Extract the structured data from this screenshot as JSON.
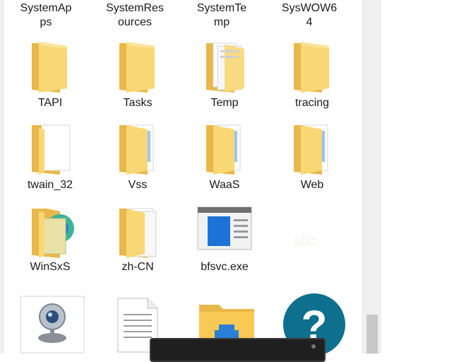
{
  "top_row": [
    {
      "name": "SystemApps",
      "line1": "SystemAp",
      "line2": "ps"
    },
    {
      "name": "SystemResources",
      "line1": "SystemRes",
      "line2": "ources"
    },
    {
      "name": "SystemTemp",
      "line1": "SystemTe",
      "line2": "mp"
    },
    {
      "name": "SysWOW64",
      "line1": "SysWOW6",
      "line2": "4"
    }
  ],
  "row2": [
    "TAPI",
    "Tasks",
    "Temp",
    "tracing"
  ],
  "row3": [
    "twain_32",
    "Vss",
    "WaaS",
    "Web"
  ],
  "row4": [
    "WinSxS",
    "zh-CN",
    "bfsvc.exe"
  ],
  "faint_watermark": "abc",
  "icons": {
    "folder": "folder-icon",
    "folder_docs": "folder-with-documents-icon",
    "exe": "exe-window-icon",
    "webcam": "webcam-icon",
    "text_file": "text-document-icon",
    "explorer": "file-explorer-icon",
    "help": "help-question-icon"
  },
  "colors": {
    "folder_back": "#e9b84a",
    "folder_front": "#f8d775",
    "exe_blue": "#1e73d8",
    "help_teal": "#0f6f8e"
  }
}
